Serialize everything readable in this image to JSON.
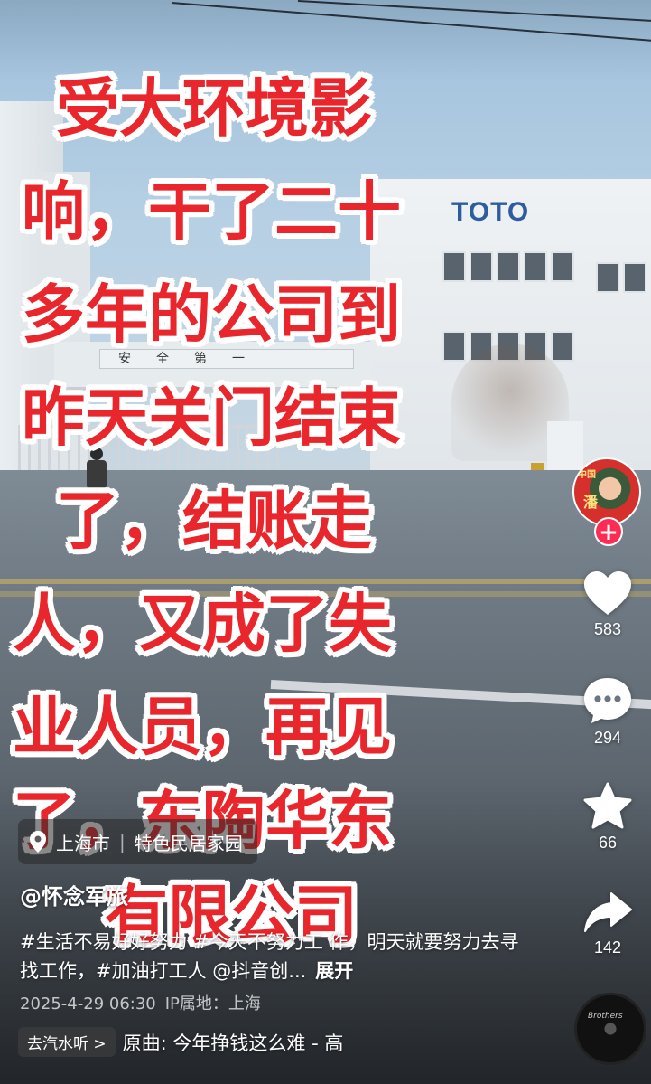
{
  "caption": {
    "lines": [
      "受大环境影",
      "响，干了二十",
      "多年的公司到",
      "昨天关门结束",
      "了，结账走",
      "人，又成了失",
      "业人员，再见",
      "了，东陶华东",
      "有限公司"
    ]
  },
  "scene": {
    "building_logo": "TOTO",
    "gate_sign": "安全第一"
  },
  "rail": {
    "avatar_badge": "中国",
    "avatar_char": "潘",
    "follow_symbol": "+",
    "like_count": "583",
    "comment_count": "294",
    "favorite_count": "66",
    "share_count": "142"
  },
  "location": {
    "city": "上海市",
    "place": "特色民居家园"
  },
  "author": "@怀念军旅",
  "description": {
    "text": "#生活不易好好努力 #今天不努力工 作，明天就要努力去寻找工作，#加油打工人 @抖音创...",
    "expand_label": "展开"
  },
  "meta": {
    "date": "2025-4-29 06:30",
    "ip_location": "IP属地：上海"
  },
  "music": {
    "chip_label": "去汽水听 >",
    "track": "原曲: 今年挣钱这么难 - 高",
    "disc_text": "Brothers"
  },
  "colors": {
    "caption_red": "#e8262c",
    "follow_red": "#fe2c55",
    "toto_blue": "#2d5d9e"
  },
  "icons": {
    "location": "location-pin-icon",
    "like": "heart-icon",
    "comment": "comment-bubble-icon",
    "favorite": "star-icon",
    "share": "share-arrow-icon",
    "music": "music-disc-icon"
  }
}
